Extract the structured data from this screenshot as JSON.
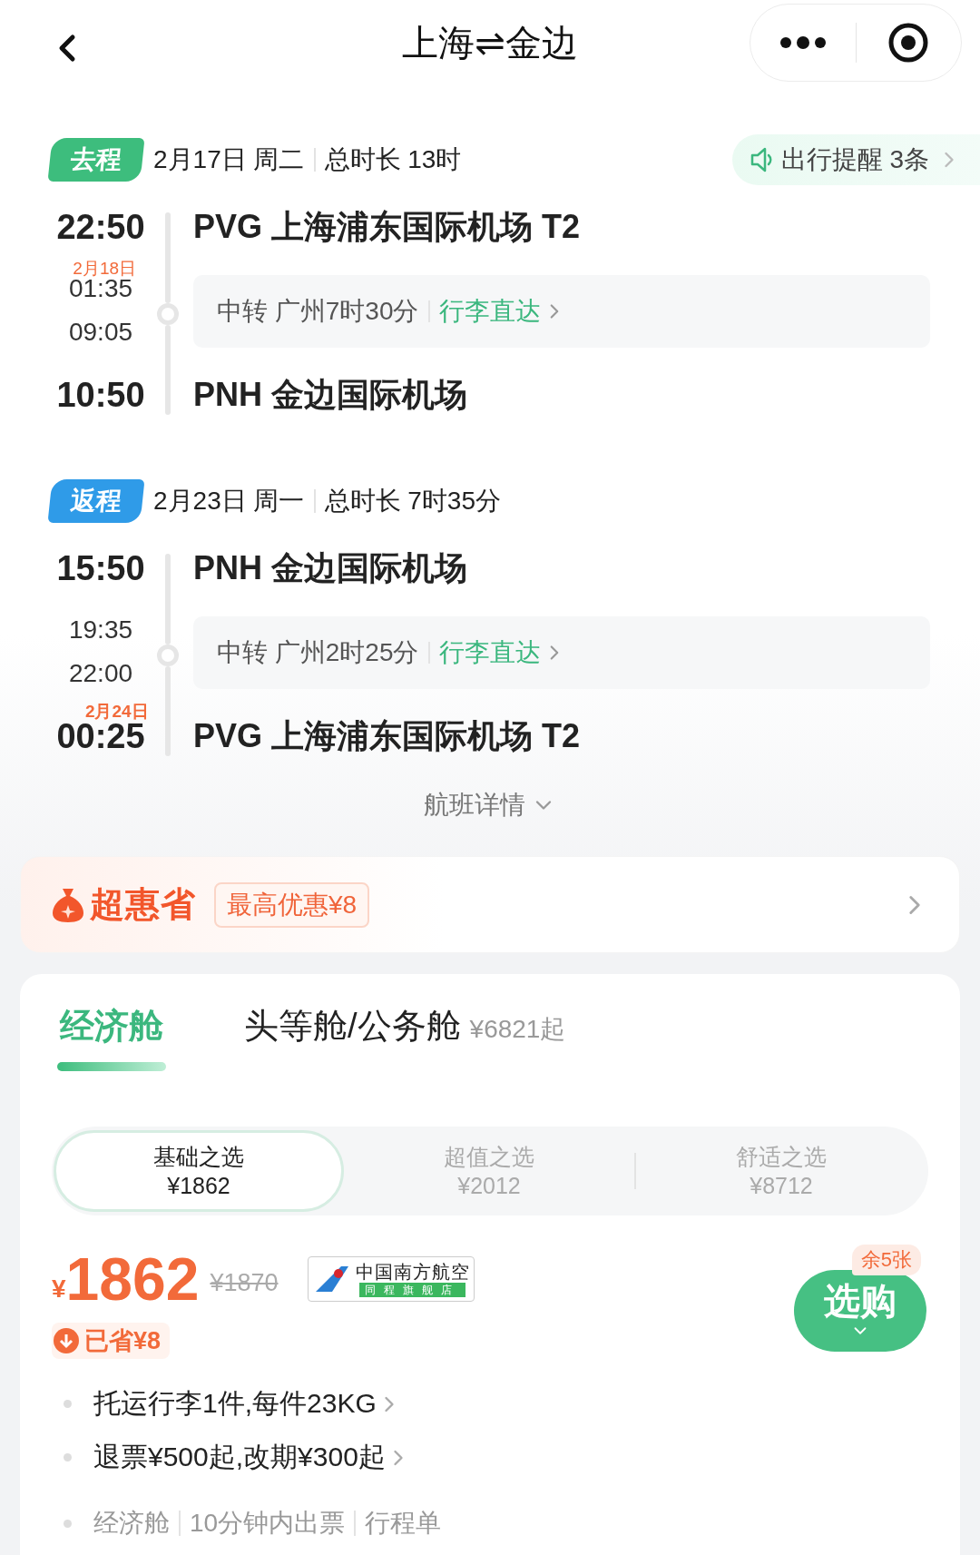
{
  "header": {
    "title": "上海⇌金边"
  },
  "trips": [
    {
      "tag": "去程",
      "color": "#3dbd7d",
      "date": "2月17日 周二",
      "duration": "总时长 13时",
      "reminder": "出行提醒 3条",
      "departure": {
        "time": "22:50",
        "airport": "PVG 上海浦东国际机场 T2"
      },
      "transfer": {
        "arrive_note": "2月18日",
        "arrive_time": "01:35",
        "depart_time": "09:05",
        "info": "中转 广州7时30分",
        "baggage": "行李直达"
      },
      "arrival": {
        "time": "10:50",
        "airport": "PNH 金边国际机场"
      }
    },
    {
      "tag": "返程",
      "color": "#2f9be8",
      "date": "2月23日 周一",
      "duration": "总时长 7时35分",
      "departure": {
        "time": "15:50",
        "airport": "PNH 金边国际机场"
      },
      "transfer": {
        "arrive_time": "19:35",
        "depart_time": "22:00",
        "info": "中转 广州2时25分",
        "baggage": "行李直达"
      },
      "arrival": {
        "note": "2月24日",
        "time": "00:25",
        "airport": "PVG 上海浦东国际机场 T2"
      }
    }
  ],
  "flight_details": "航班详情",
  "promo": {
    "brand": "超惠省",
    "offer": "最高优惠¥8"
  },
  "cabin_tabs": [
    {
      "label": "经济舱",
      "selected": true
    },
    {
      "label": "头等舱/公务舱",
      "price": "¥6821起",
      "selected": false
    }
  ],
  "fare_options": [
    {
      "name": "基础之选",
      "price": "¥1862",
      "selected": true
    },
    {
      "name": "超值之选",
      "price": "¥2012",
      "selected": false
    },
    {
      "name": "舒适之选",
      "price": "¥8712",
      "selected": false
    }
  ],
  "offer": {
    "currency": "¥",
    "price": "1862",
    "original_price": "¥1870",
    "airline": "中国南方航空",
    "store": "同程旗舰店",
    "saved": "已省¥8",
    "remaining": "余5张",
    "buy": "选购",
    "features": [
      "托运行李1件,每件23KG",
      "退票¥500起,改期¥300起"
    ],
    "tags": [
      "经济舱",
      "10分钟内出票",
      "行程单"
    ]
  }
}
